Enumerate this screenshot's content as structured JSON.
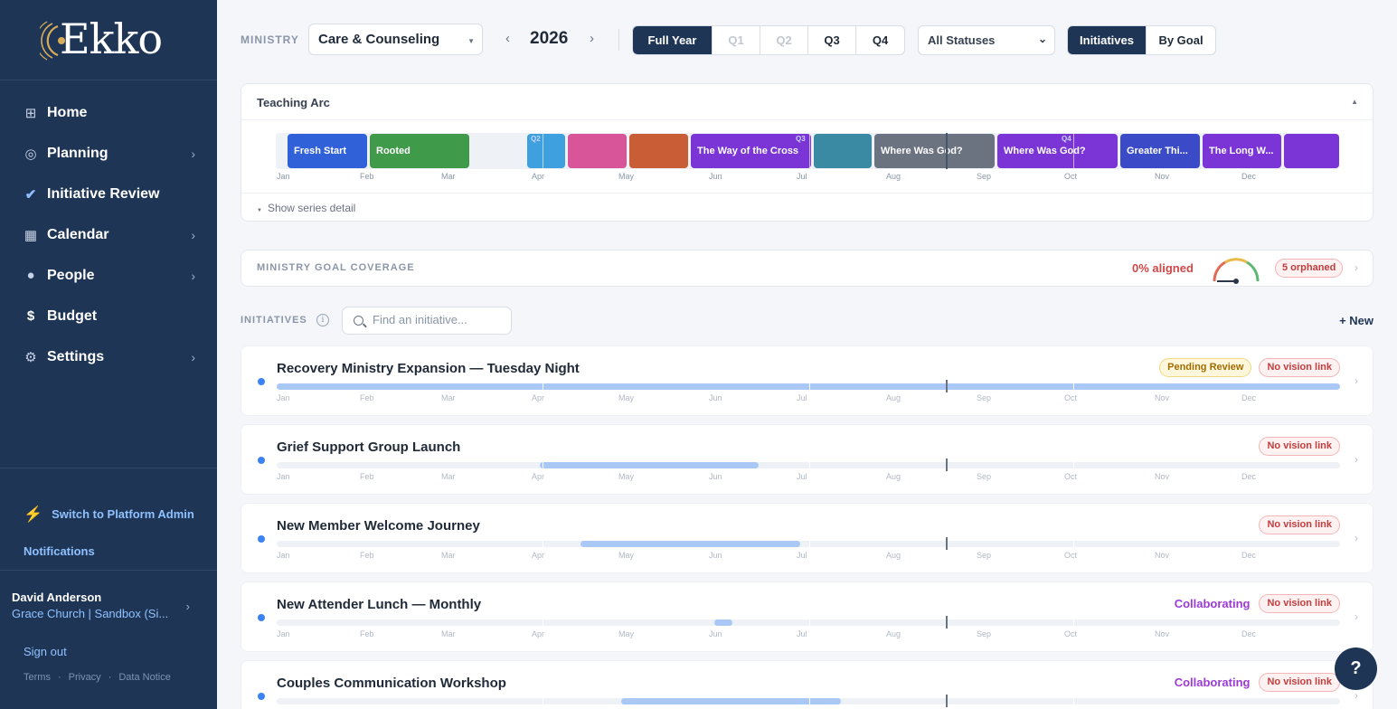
{
  "app": {
    "logo_text": "Ekko"
  },
  "sidebar": {
    "items": [
      {
        "label": "Home",
        "icon": "grid-icon",
        "chevron": false
      },
      {
        "label": "Planning",
        "icon": "target-icon",
        "chevron": true
      },
      {
        "label": "Initiative Review",
        "icon": "check-icon",
        "chevron": true
      },
      {
        "label": "Calendar",
        "icon": "calendar-icon",
        "chevron": true
      },
      {
        "label": "People",
        "icon": "person-icon",
        "chevron": true
      },
      {
        "label": "Budget",
        "icon": "dollar-icon",
        "chevron": false
      },
      {
        "label": "Settings",
        "icon": "gear-icon",
        "chevron": true
      }
    ],
    "switch_admin": "Switch to Platform Admin",
    "notifications": "Notifications",
    "user_name": "David Anderson",
    "user_org": "Grace Church | Sandbox (Si...",
    "sign_out": "Sign out",
    "legal": [
      "Terms",
      "Privacy",
      "Data Notice"
    ]
  },
  "topbar": {
    "ministry_label": "MINISTRY",
    "ministry_value": "Care & Counseling",
    "year": "2026",
    "periods": [
      "Full Year",
      "Q1",
      "Q2",
      "Q3",
      "Q4"
    ],
    "active_period": "Full Year",
    "status_filter": "All Statuses",
    "views": [
      "Initiatives",
      "By Goal"
    ],
    "active_view": "Initiatives"
  },
  "teaching_arc": {
    "title": "Teaching Arc",
    "months": [
      "Jan",
      "Feb",
      "Mar",
      "Apr",
      "May",
      "Jun",
      "Jul",
      "Aug",
      "Sep",
      "Oct",
      "Nov",
      "Dec"
    ],
    "quarter_marks": [
      "Q2",
      "Q3",
      "Q4"
    ],
    "series": [
      {
        "label": "Fresh Start",
        "color": "#3161d9"
      },
      {
        "label": "Rooted",
        "color": "#3f9a4a"
      },
      {
        "label": "",
        "color": "#3fa0e0"
      },
      {
        "label": "",
        "color": "#d9559a"
      },
      {
        "label": "",
        "color": "#c95d35"
      },
      {
        "label": "The Way of the Cross",
        "color": "#7b35d6"
      },
      {
        "label": "",
        "color": "#3a8aa3"
      },
      {
        "label": "Where Was God?",
        "color": "#6b7280"
      },
      {
        "label": "Where Was God?",
        "color": "#7b35d6"
      },
      {
        "label": "Greater Thi...",
        "color": "#3b4bc8"
      },
      {
        "label": "The Long W...",
        "color": "#7b35d6"
      },
      {
        "label": "",
        "color": "#7b35d6"
      }
    ],
    "show_detail": "Show series detail"
  },
  "goal_coverage": {
    "label": "MINISTRY GOAL COVERAGE",
    "aligned": "0% aligned",
    "orphaned": "5 orphaned"
  },
  "initiatives": {
    "label": "INITIATIVES",
    "search_placeholder": "Find an initiative...",
    "new_label": "+ New",
    "rows": [
      {
        "title": "Recovery Ministry Expansion — Tuesday Night",
        "status": "Pending Review",
        "vision": "No vision link"
      },
      {
        "title": "Grief Support Group Launch",
        "status": "",
        "vision": "No vision link"
      },
      {
        "title": "New Member Welcome Journey",
        "status": "",
        "vision": "No vision link"
      },
      {
        "title": "New Attender Lunch — Monthly",
        "status": "Collaborating",
        "vision": "No vision link"
      },
      {
        "title": "Couples Communication Workshop",
        "status": "Collaborating",
        "vision": "No vision link"
      }
    ]
  },
  "help_label": "?"
}
